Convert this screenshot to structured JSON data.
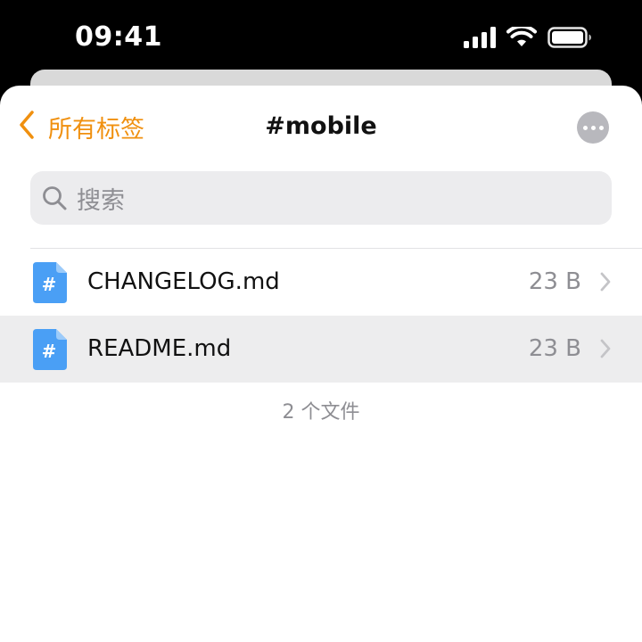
{
  "status_bar": {
    "time": "09:41",
    "icons": [
      "cellular-signal-icon",
      "wifi-icon",
      "battery-icon"
    ]
  },
  "nav": {
    "back_label": "所有标签",
    "title": "#mobile",
    "more_icon": "ellipsis-icon"
  },
  "search": {
    "placeholder": "搜索"
  },
  "files": [
    {
      "name": "CHANGELOG.md",
      "size": "23 B",
      "icon": "markdown-file-icon",
      "selected": false
    },
    {
      "name": "README.md",
      "size": "23 B",
      "icon": "markdown-file-icon",
      "selected": true
    }
  ],
  "footer": {
    "count_label": "2 个文件"
  },
  "colors": {
    "accent": "#f0900f",
    "file_icon": "#4a9ff5",
    "secondary_text": "#8e8e93",
    "selected_row": "#ededee"
  }
}
